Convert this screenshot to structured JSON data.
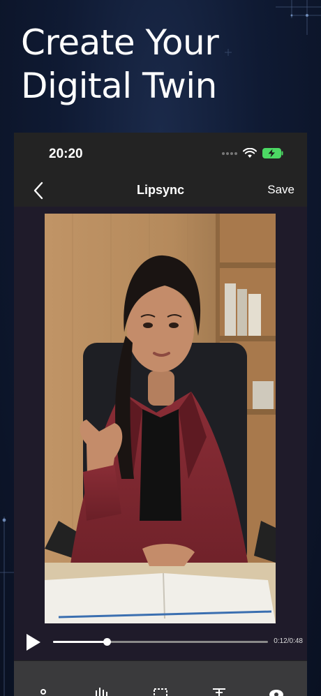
{
  "headline": {
    "line1": "Create Your",
    "line2": "Digital Twin"
  },
  "status_bar": {
    "time": "20:20",
    "icons": [
      "signal-icon",
      "wifi-icon",
      "battery-charging-icon"
    ]
  },
  "nav": {
    "back_icon": "chevron-left-icon",
    "title": "Lipsync",
    "save_label": "Save"
  },
  "video": {
    "subject": "woman in maroon blazer seated at desk with open book"
  },
  "player": {
    "play_icon": "play-icon",
    "time": "0:12/0:48",
    "progress": 0.25
  },
  "toolbar": {
    "icons": [
      "voice-tool-icon",
      "audio-wave-icon",
      "crop-icon",
      "text-align-icon",
      "eye-icon"
    ]
  },
  "colors": {
    "background": "#0f1a33",
    "phone_frame": "#232323",
    "blazer": "#7e2730",
    "toolbar": "#3a3a3c",
    "battery": "#4cd964"
  }
}
